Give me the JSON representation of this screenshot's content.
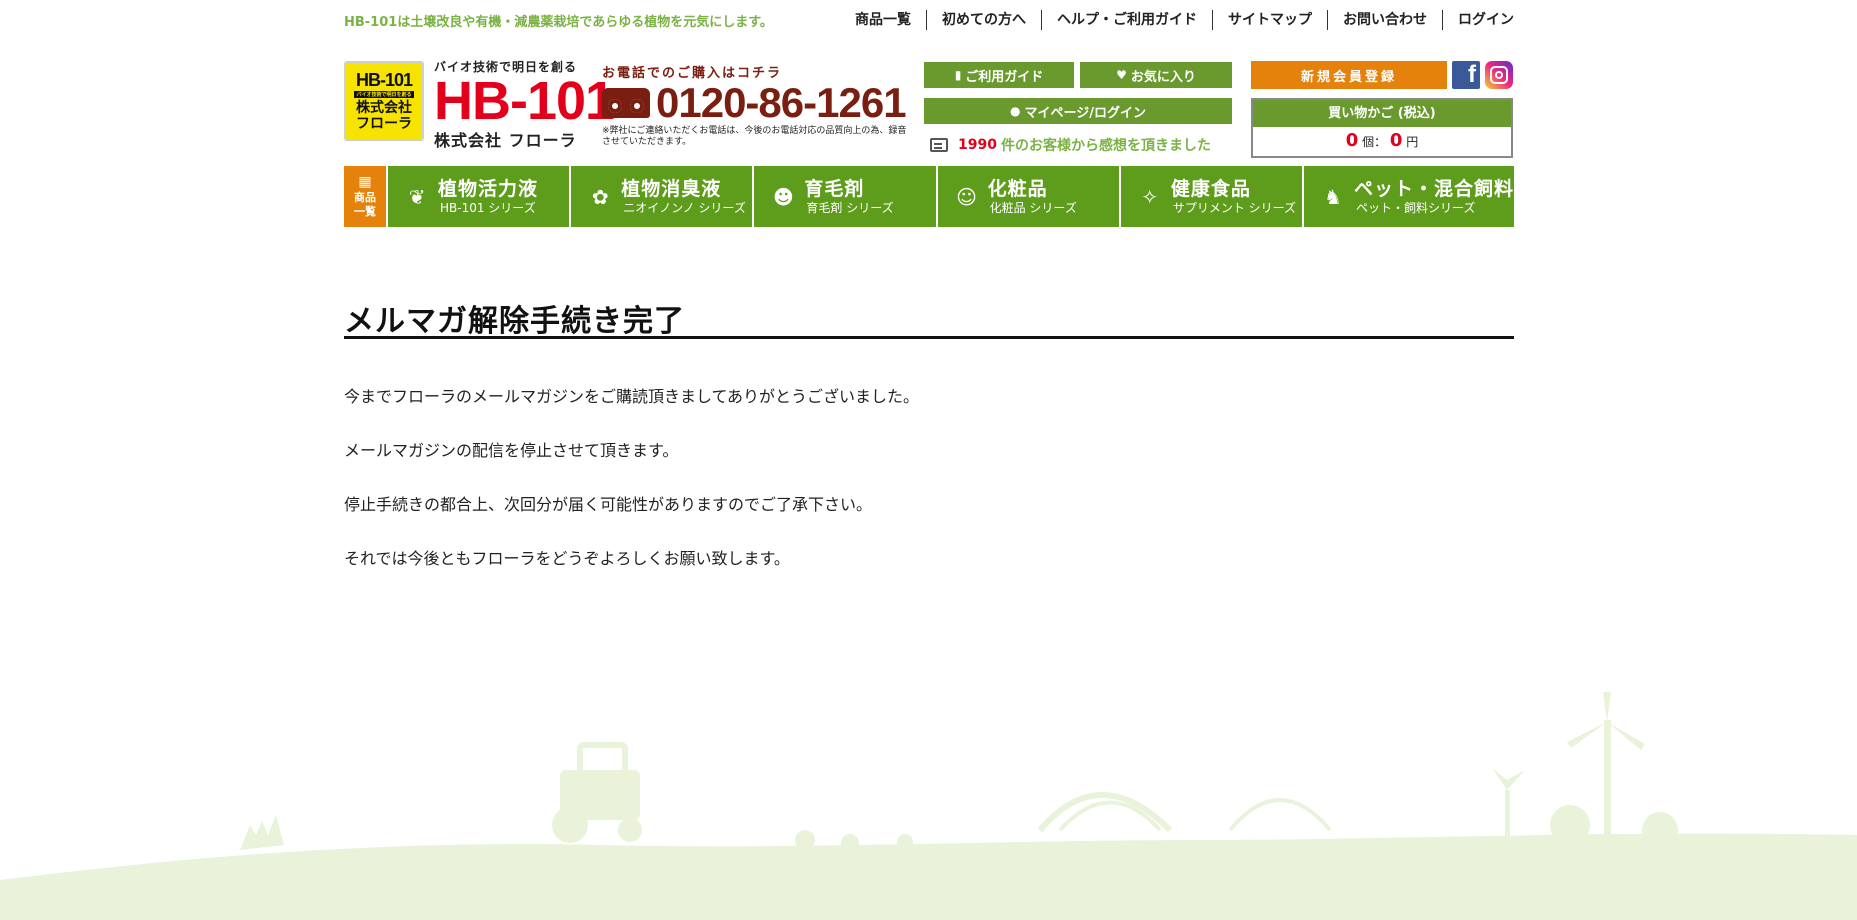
{
  "header": {
    "tagline": "HB-101は土壌改良や有機・減農薬栽培であらゆる植物を元気にします。",
    "top_nav": [
      "商品一覧",
      "初めての方へ",
      "ヘルプ・ご利用ガイド",
      "サイトマップ",
      "お問い合わせ",
      "ログイン"
    ]
  },
  "logo": {
    "badge_line1": "HB-101",
    "badge_line2": "バイオ技術で明日を創る",
    "badge_line3": "株式会社",
    "badge_line4": "フローラ",
    "slogan": "バイオ技術で明日を創る",
    "brand": "HB-101",
    "company": "株式会社 フローラ"
  },
  "phone": {
    "lead": "お電話でのご購入はコチラ",
    "number": "0120-86-1261",
    "note": "※弊社にご連絡いただくお電話は、今後のお電話対応の品質向上の為、録音させていただきます。"
  },
  "buttons": {
    "guide": "ご利用ガイド",
    "favorites": "お気に入り",
    "mypage": "マイページ/ログイン",
    "register": "新規会員登録"
  },
  "review": {
    "count": "1990",
    "text": "件のお客様から感想を頂きました"
  },
  "social": {
    "facebook_letter": "f"
  },
  "cart": {
    "title": "買い物かご (税込)",
    "items": "0",
    "items_unit": "個：",
    "total": "0",
    "total_unit": "円"
  },
  "category_nav": {
    "all_label_1": "商品",
    "all_label_2": "一覧",
    "items": [
      {
        "name": "植物活力液",
        "sub": "HB-101 シリーズ",
        "icon": "sprout-icon"
      },
      {
        "name": "植物消臭液",
        "sub": "ニオイノンノ シリーズ",
        "icon": "deodorant-icon"
      },
      {
        "name": "育毛剤",
        "sub": "育毛剤 シリーズ",
        "icon": "hair-icon"
      },
      {
        "name": "化粧品",
        "sub": "化粧品 シリーズ",
        "icon": "face-icon"
      },
      {
        "name": "健康食品",
        "sub": "サプリメント シリーズ",
        "icon": "health-icon"
      },
      {
        "name": "ペット・混合飼料",
        "sub": "ペット・飼料シリーズ",
        "icon": "pet-icon"
      }
    ]
  },
  "main": {
    "title": "メルマガ解除手続き完了",
    "paragraphs": [
      "今までフローラのメールマガジンをご購読頂きましてありがとうございました。",
      "メールマガジンの配信を停止させて頂きます。",
      "停止手続きの都合上、次回分が届く可能性がありますのでご了承下さい。",
      "それでは今後ともフローラをどうぞよろしくお願い致します。"
    ]
  },
  "colors": {
    "accent_green": "#5e9c1c",
    "button_green": "#6a9a2e",
    "tagline_green": "#7ab244",
    "orange": "#e4820b",
    "brand_red": "#e2001a",
    "phone_brown": "#7a1e12",
    "landscape_green": "#e8f3da"
  }
}
